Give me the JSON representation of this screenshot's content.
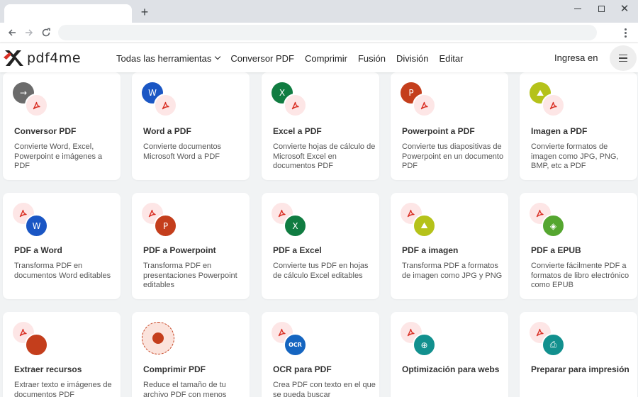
{
  "browser": {
    "new_tab": "+"
  },
  "site": {
    "logo_text": "pdf4me",
    "nav": [
      {
        "label": "Todas las herramientas"
      },
      {
        "label": "Conversor PDF"
      },
      {
        "label": "Comprimir"
      },
      {
        "label": "Fusión"
      },
      {
        "label": "División"
      },
      {
        "label": "Editar"
      }
    ],
    "login": "Ingresa en"
  },
  "colors": {
    "pdf_red": "#d93025",
    "pdf_bg": "#fde6e6",
    "word_blue": "#1a56c4",
    "excel_green": "#107c41",
    "ppt_red": "#c43e1c",
    "image_olive": "#b5c21a",
    "epub_green": "#55a630",
    "ocr_blue": "#1565c0",
    "web_teal": "#12908e",
    "print_teal": "#12908e",
    "converter_gray": "#6b6b6b"
  },
  "tools": [
    {
      "title": "Conversor PDF",
      "desc": "Convierte Word, Excel, Powerpoint e imágenes a PDF",
      "icon": "converter-icon",
      "glyph": "→"
    },
    {
      "title": "Word a PDF",
      "desc": "Convierte documentos Microsoft Word a PDF",
      "icon": "word-icon",
      "glyph": "W"
    },
    {
      "title": "Excel a PDF",
      "desc": "Convierte hojas de cálculo de Microsoft Excel en documentos PDF",
      "icon": "excel-icon",
      "glyph": "X"
    },
    {
      "title": "Powerpoint a PDF",
      "desc": "Convierte tus diapositivas de Powerpoint en un documento PDF",
      "icon": "powerpoint-icon",
      "glyph": "P"
    },
    {
      "title": "Imagen a PDF",
      "desc": "Convierte formatos de imagen como JPG, PNG, BMP, etc a PDF",
      "icon": "image-icon",
      "glyph": "⛰"
    },
    {
      "title": "PDF a Word",
      "desc": "Transforma PDF en documentos Word editables",
      "icon": "word-icon",
      "glyph": "W"
    },
    {
      "title": "PDF a Powerpoint",
      "desc": "Transforma PDF en presentaciones Powerpoint editables",
      "icon": "powerpoint-icon",
      "glyph": "P"
    },
    {
      "title": "PDF a Excel",
      "desc": "Convierte tus PDF en hojas de cálculo Excel editables",
      "icon": "excel-icon",
      "glyph": "X"
    },
    {
      "title": "PDF a imagen",
      "desc": "Transforma PDF a formatos de imagen como JPG y PNG",
      "icon": "image-icon",
      "glyph": "⛰"
    },
    {
      "title": "PDF a EPUB",
      "desc": "Convierte fácilmente PDF a formatos de libro electrónico como EPUB",
      "icon": "epub-icon",
      "glyph": "◈"
    },
    {
      "title": "Extraer recursos",
      "desc": "Extraer texto e imágenes de documentos PDF",
      "icon": "extract-icon",
      "glyph": ""
    },
    {
      "title": "Comprimir PDF",
      "desc": "Reduce el tamaño de tu archivo PDF con menos",
      "icon": "compress-icon",
      "glyph": ""
    },
    {
      "title": "OCR para PDF",
      "desc": "Crea PDF con texto en el que se pueda buscar",
      "icon": "ocr-icon",
      "glyph": "OCR"
    },
    {
      "title": "Optimización para webs",
      "desc": "",
      "icon": "web-icon",
      "glyph": "⊕"
    },
    {
      "title": "Preparar para impresión",
      "desc": "",
      "icon": "print-icon",
      "glyph": "⎙"
    }
  ]
}
